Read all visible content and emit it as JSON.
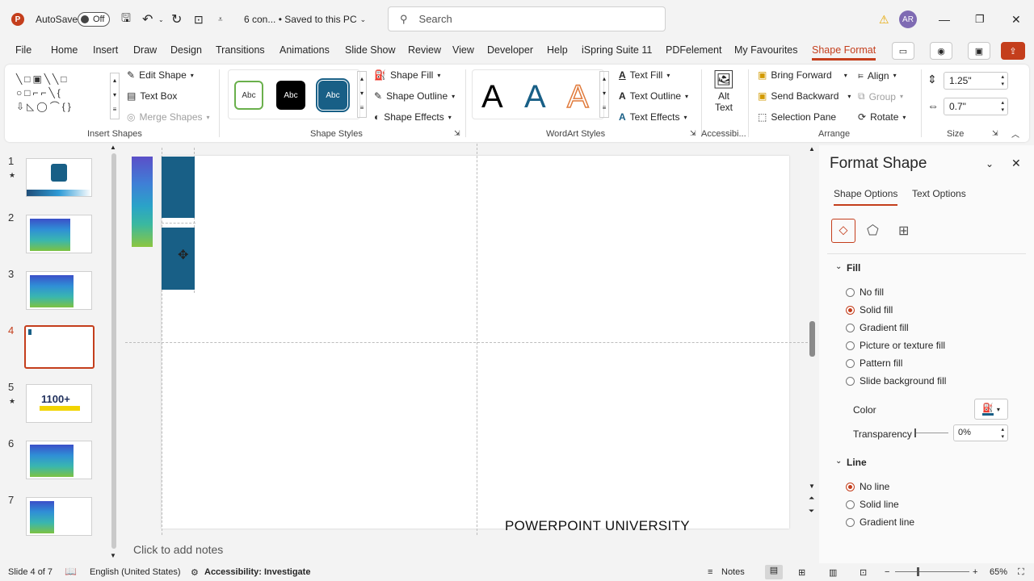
{
  "titlebar": {
    "autosave_label": "AutoSave",
    "autosave_state": "Off",
    "doc_title": "6 con... • Saved to this PC",
    "search_placeholder": "Search",
    "user_initials": "AR"
  },
  "tabs": [
    "File",
    "Home",
    "Insert",
    "Draw",
    "Design",
    "Transitions",
    "Animations",
    "Slide Show",
    "Review",
    "View",
    "Developer",
    "Help",
    "iSpring Suite 11",
    "PDFelement",
    "My Favourites",
    "Shape Format"
  ],
  "active_tab": "Shape Format",
  "ribbon": {
    "insert_shapes": {
      "label": "Insert Shapes",
      "edit_shape": "Edit Shape",
      "text_box": "Text Box",
      "merge_shapes": "Merge Shapes"
    },
    "shape_styles": {
      "label": "Shape Styles",
      "samples": [
        "Abc",
        "Abc",
        "Abc"
      ],
      "shape_fill": "Shape Fill",
      "shape_outline": "Shape Outline",
      "shape_effects": "Shape Effects"
    },
    "wordart": {
      "label": "WordArt Styles",
      "sample": "A",
      "text_fill": "Text Fill",
      "text_outline": "Text Outline",
      "text_effects": "Text Effects"
    },
    "accessibility": {
      "label": "Accessibi...",
      "alt_text_line1": "Alt",
      "alt_text_line2": "Text"
    },
    "arrange": {
      "label": "Arrange",
      "bring_forward": "Bring Forward",
      "send_backward": "Send Backward",
      "selection_pane": "Selection Pane",
      "align": "Align",
      "group": "Group",
      "rotate": "Rotate"
    },
    "size": {
      "label": "Size",
      "height": "1.25\"",
      "width": "0.7\""
    }
  },
  "slides": [
    {
      "num": "1",
      "star": true
    },
    {
      "num": "2",
      "star": false
    },
    {
      "num": "3",
      "star": false
    },
    {
      "num": "4",
      "star": false
    },
    {
      "num": "5",
      "star": true,
      "title": "1100+"
    },
    {
      "num": "6",
      "star": false
    },
    {
      "num": "7",
      "star": false
    }
  ],
  "active_slide": "4",
  "slide_footer": "POWERPOINT UNIVERSITY",
  "notes_placeholder": "Click to add notes",
  "format_pane": {
    "title": "Format Shape",
    "tabs": [
      "Shape Options",
      "Text Options"
    ],
    "fill_section": "Fill",
    "fill_options": [
      "No fill",
      "Solid fill",
      "Gradient fill",
      "Picture or texture fill",
      "Pattern fill",
      "Slide background fill"
    ],
    "fill_selected": "Solid fill",
    "color_label": "Color",
    "transparency_label": "Transparency",
    "transparency_value": "0%",
    "line_section": "Line",
    "line_options": [
      "No line",
      "Solid line",
      "Gradient line"
    ],
    "line_selected": "No line"
  },
  "statusbar": {
    "slide_info": "Slide 4 of 7",
    "language": "English (United States)",
    "accessibility": "Accessibility: Investigate",
    "notes": "Notes",
    "zoom": "65%"
  },
  "colors": {
    "accent": "#c43e1c",
    "shape_fill": "#185f86"
  }
}
